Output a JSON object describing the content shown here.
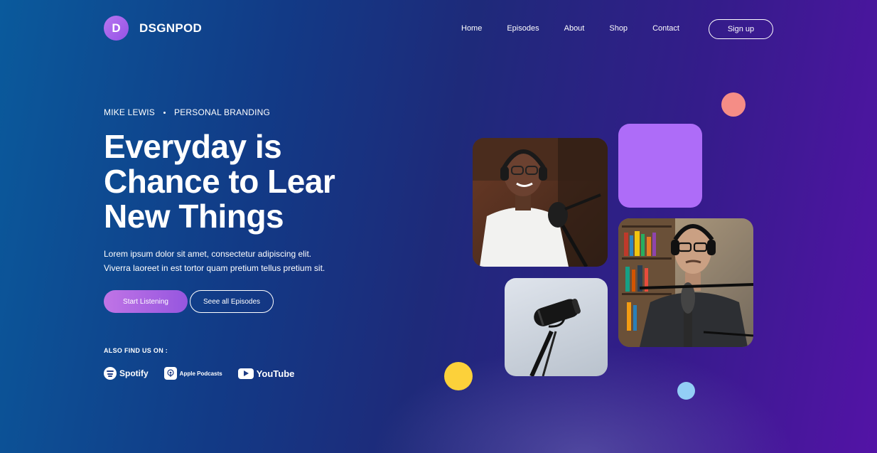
{
  "brand": {
    "initial": "D",
    "name": "DSGNPOD",
    "accent": "#a765ec"
  },
  "nav": {
    "items": [
      "Home",
      "Episodes",
      "About",
      "Shop",
      "Contact"
    ],
    "signup_label": "Sign up"
  },
  "hero": {
    "author": "MIKE LEWIS",
    "topic": "PERSONAL BRANDING",
    "headline": [
      "Everyday is",
      "Chance to Lear",
      "New Things"
    ],
    "lead": [
      "Lorem ipsum dolor sit amet, consectetur adipiscing elit.",
      "Viverra laoreet in est tortor quam pretium tellus pretium sit."
    ],
    "primary_cta": "Start Listening",
    "secondary_cta": "Seee all Episodes"
  },
  "find_us": {
    "label": "ALSO FIND US ON :",
    "platforms": [
      {
        "name": "Spotify",
        "icon": "spotify-icon"
      },
      {
        "name": "Apple Podcasts",
        "icon": "apple-podcasts-icon"
      },
      {
        "name": "YouTube",
        "icon": "youtube-icon"
      }
    ]
  },
  "gallery": {
    "images": [
      "podcaster-smiling-headphones-photo",
      "studio-microphone-photo",
      "podcaster-glasses-microphone-photo"
    ],
    "decor_colors": {
      "violet": "#ae6cf8",
      "coral": "#f58d86",
      "yellow": "#fcd13a",
      "light_blue": "#93cef6"
    }
  }
}
